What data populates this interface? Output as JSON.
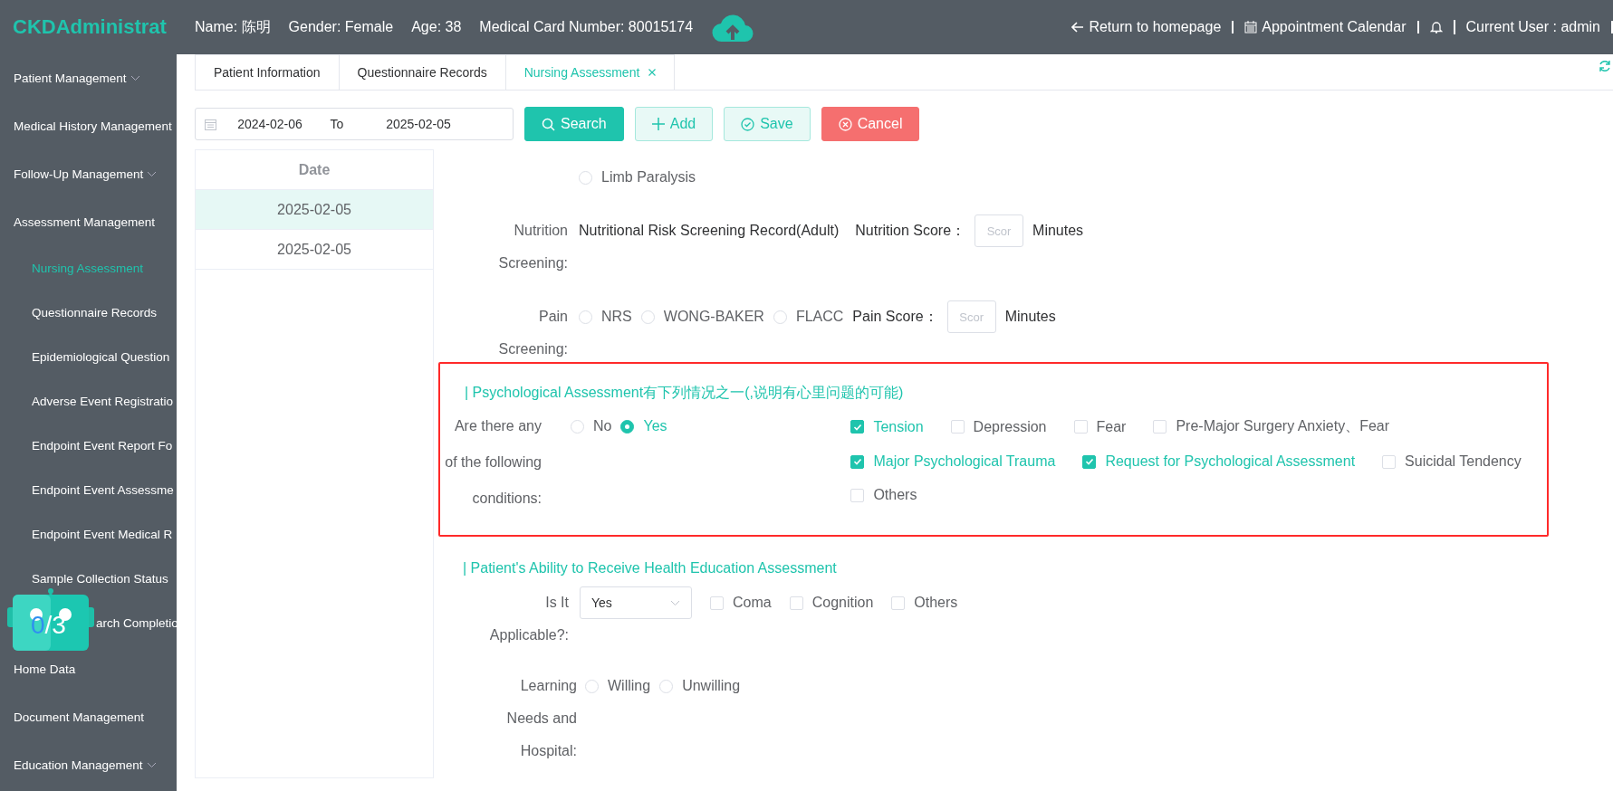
{
  "logo": "CKDAdministrat",
  "patient_info": [
    "Name: 陈明",
    "Gender: Female",
    "Age: 38",
    "Medical Card Number: 80015174"
  ],
  "header_links": [
    {
      "kind": "back",
      "label": "Return to homepage"
    },
    {
      "kind": "calendar",
      "label": "Appointment Calendar"
    },
    {
      "kind": "bell"
    },
    {
      "kind": "user",
      "label": "Current User : admin"
    }
  ],
  "sidebar": {
    "items": [
      {
        "kind": "group",
        "label": "Patient Management",
        "expandable": true,
        "selected": false
      },
      {
        "kind": "group",
        "label": "Medical History Management",
        "expandable": false,
        "selected": false
      },
      {
        "kind": "group",
        "label": "Follow-Up Management",
        "expandable": true,
        "selected": false
      },
      {
        "kind": "group",
        "label": "Assessment Management",
        "expandable": false,
        "selected": false
      },
      {
        "kind": "sub",
        "label": "Nursing Assessment",
        "expandable": false,
        "selected": true
      },
      {
        "kind": "sub",
        "label": "Questionnaire Records",
        "expandable": false,
        "selected": false
      },
      {
        "kind": "sub",
        "label": "Epidemiological Question",
        "expandable": false,
        "selected": false
      },
      {
        "kind": "sub",
        "label": "Adverse Event Registratio",
        "expandable": false,
        "selected": false
      },
      {
        "kind": "sub",
        "label": "Endpoint Event Report Fo",
        "expandable": false,
        "selected": false
      },
      {
        "kind": "sub",
        "label": "Endpoint Event Assessme",
        "expandable": false,
        "selected": false
      },
      {
        "kind": "sub",
        "label": "Endpoint Event Medical R",
        "expandable": false,
        "selected": false
      },
      {
        "kind": "sub",
        "label": "Sample Collection Status",
        "expandable": false,
        "selected": false
      },
      {
        "kind": "covered",
        "label": "arch Completio",
        "expandable": false,
        "selected": false
      },
      {
        "kind": "group",
        "label": "Home Data",
        "expandable": false,
        "selected": false
      },
      {
        "kind": "group",
        "label": "Document Management",
        "expandable": false,
        "selected": false
      },
      {
        "kind": "group",
        "label": "Education Management",
        "expandable": true,
        "selected": false
      }
    ],
    "robot": {
      "done": "0",
      "total": "/3"
    }
  },
  "tabs": [
    {
      "label": "Patient Information",
      "selected": false,
      "closable": false
    },
    {
      "label": "Questionnaire Records",
      "selected": false,
      "closable": false
    },
    {
      "label": "Nursing Assessment",
      "selected": true,
      "closable": true
    }
  ],
  "date_range": {
    "start": "2024-02-06",
    "separator": "To",
    "end": "2025-02-05"
  },
  "buttons": [
    {
      "kind": "search",
      "label": "Search"
    },
    {
      "kind": "add",
      "label": "Add"
    },
    {
      "kind": "save",
      "label": "Save"
    },
    {
      "kind": "cancel",
      "label": "Cancel"
    }
  ],
  "date_list": {
    "header": "Date",
    "rows": [
      {
        "date": "2025-02-05",
        "selected": true
      },
      {
        "date": "2025-02-05",
        "selected": false
      }
    ]
  },
  "limb_option": {
    "label": "Limb Paralysis",
    "selected": false
  },
  "nutrition": {
    "label": "Nutrition Screening:",
    "record": "Nutritional Risk Screening Record(Adult)",
    "score_label": "Nutrition Score：",
    "placeholder": "Scor",
    "unit": "Minutes"
  },
  "pain": {
    "label": "Pain Screening:",
    "options": [
      {
        "label": "NRS",
        "selected": false
      },
      {
        "label": "WONG-BAKER",
        "selected": false
      },
      {
        "label": "FLACC",
        "selected": false
      }
    ],
    "score_label": "Pain Score：",
    "placeholder": "Scor",
    "unit": "Minutes"
  },
  "psychological": {
    "highlighted": true,
    "title": "| Psychological Assessment有下列情况之一(,说明有心里问题的可能)",
    "question": "Are there any of the following conditions:",
    "answers": [
      {
        "label": "No",
        "selected": false
      },
      {
        "label": "Yes",
        "selected": true
      }
    ],
    "conditions": [
      {
        "label": "Tension",
        "checked": true
      },
      {
        "label": "Depression",
        "checked": false
      },
      {
        "label": "Fear",
        "checked": false
      },
      {
        "label": "Pre-Major Surgery Anxiety、Fear",
        "checked": false
      },
      {
        "label": "Major Psychological Trauma",
        "checked": true
      },
      {
        "label": "Request for Psychological Assessment",
        "checked": true
      },
      {
        "label": "Suicidal Tendency",
        "checked": false
      },
      {
        "label": "Others",
        "checked": false
      }
    ]
  },
  "education": {
    "title": "| Patient's Ability to Receive Health Education Assessment",
    "applicable": {
      "label": "Is It Applicable?:",
      "value": "Yes",
      "options": [
        {
          "label": "Coma",
          "checked": false
        },
        {
          "label": "Cognition",
          "checked": false
        },
        {
          "label": "Others",
          "checked": false
        }
      ]
    },
    "learning": {
      "label": "Learning Needs and Hospital:",
      "options": [
        {
          "label": "Willing",
          "selected": false
        },
        {
          "label": "Unwilling",
          "selected": false
        }
      ]
    }
  }
}
